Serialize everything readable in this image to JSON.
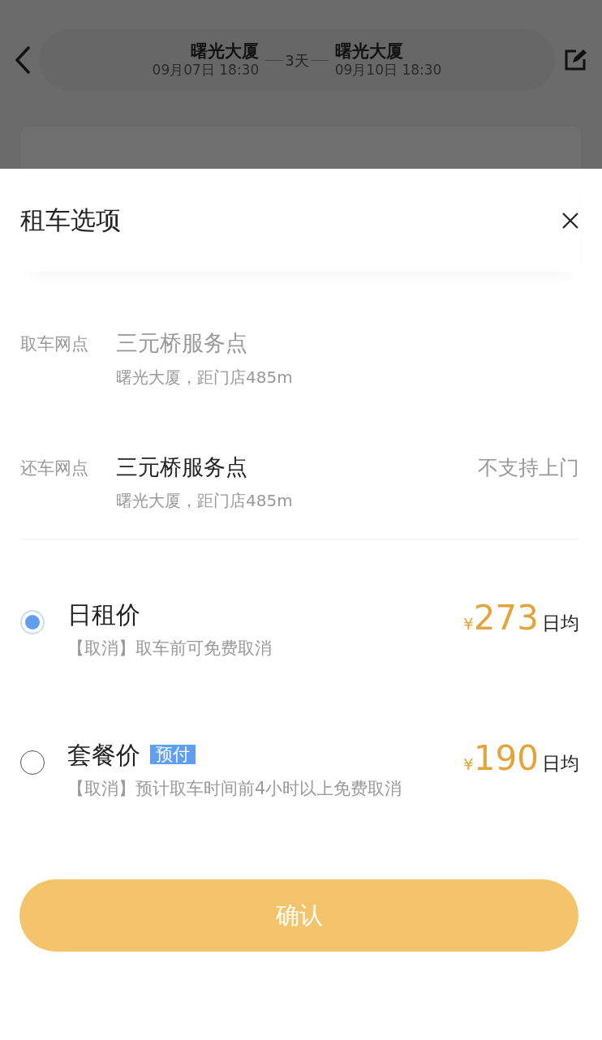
{
  "background": {
    "origin": {
      "name": "曙光大厦",
      "time": "09月07日 18:30"
    },
    "duration": "3天",
    "destination": {
      "name": "曙光大厦",
      "time": "09月10日 18:30"
    }
  },
  "sheet": {
    "title": "租车选项",
    "stations": [
      {
        "label": "取车网点",
        "name": "三元桥服务点",
        "address": "曙光大厦，距门店485m",
        "disabled": true
      },
      {
        "label": "还车网点",
        "name": "三元桥服务点",
        "address": "曙光大厦，距门店485m",
        "note": "不支持上门",
        "disabled": false
      }
    ],
    "options": [
      {
        "name": "日租价",
        "policy": "【取消】取车前可免费取消",
        "currency": "¥",
        "price": "273",
        "unit": "日均",
        "selected": true
      },
      {
        "name": "套餐价",
        "tag": "预付",
        "policy": "【取消】预计取车时间前4小时以上免费取消",
        "currency": "¥",
        "price": "190",
        "unit": "日均",
        "selected": false
      }
    ],
    "confirm": "确认"
  }
}
